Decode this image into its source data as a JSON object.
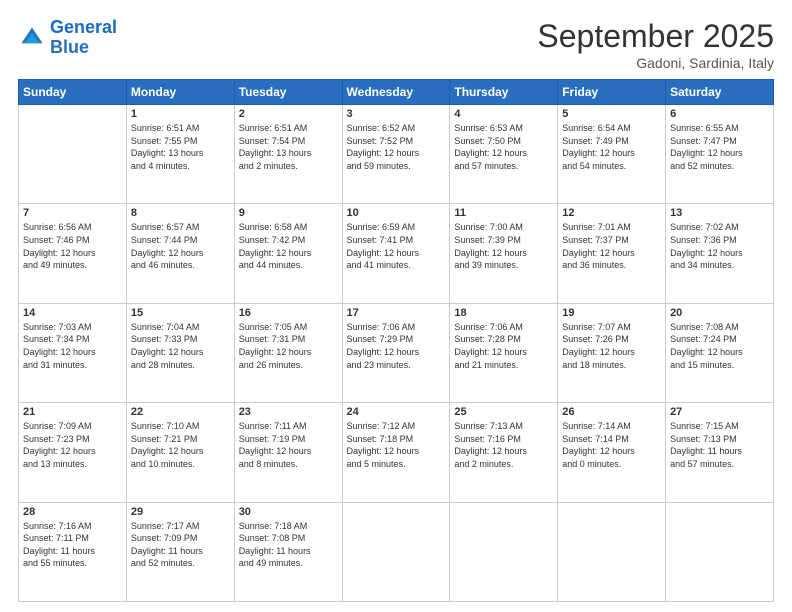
{
  "header": {
    "logo_line1": "General",
    "logo_line2": "Blue",
    "month": "September 2025",
    "location": "Gadoni, Sardinia, Italy"
  },
  "weekdays": [
    "Sunday",
    "Monday",
    "Tuesday",
    "Wednesday",
    "Thursday",
    "Friday",
    "Saturday"
  ],
  "weeks": [
    [
      {
        "day": "",
        "info": ""
      },
      {
        "day": "1",
        "info": "Sunrise: 6:51 AM\nSunset: 7:55 PM\nDaylight: 13 hours\nand 4 minutes."
      },
      {
        "day": "2",
        "info": "Sunrise: 6:51 AM\nSunset: 7:54 PM\nDaylight: 13 hours\nand 2 minutes."
      },
      {
        "day": "3",
        "info": "Sunrise: 6:52 AM\nSunset: 7:52 PM\nDaylight: 12 hours\nand 59 minutes."
      },
      {
        "day": "4",
        "info": "Sunrise: 6:53 AM\nSunset: 7:50 PM\nDaylight: 12 hours\nand 57 minutes."
      },
      {
        "day": "5",
        "info": "Sunrise: 6:54 AM\nSunset: 7:49 PM\nDaylight: 12 hours\nand 54 minutes."
      },
      {
        "day": "6",
        "info": "Sunrise: 6:55 AM\nSunset: 7:47 PM\nDaylight: 12 hours\nand 52 minutes."
      }
    ],
    [
      {
        "day": "7",
        "info": "Sunrise: 6:56 AM\nSunset: 7:46 PM\nDaylight: 12 hours\nand 49 minutes."
      },
      {
        "day": "8",
        "info": "Sunrise: 6:57 AM\nSunset: 7:44 PM\nDaylight: 12 hours\nand 46 minutes."
      },
      {
        "day": "9",
        "info": "Sunrise: 6:58 AM\nSunset: 7:42 PM\nDaylight: 12 hours\nand 44 minutes."
      },
      {
        "day": "10",
        "info": "Sunrise: 6:59 AM\nSunset: 7:41 PM\nDaylight: 12 hours\nand 41 minutes."
      },
      {
        "day": "11",
        "info": "Sunrise: 7:00 AM\nSunset: 7:39 PM\nDaylight: 12 hours\nand 39 minutes."
      },
      {
        "day": "12",
        "info": "Sunrise: 7:01 AM\nSunset: 7:37 PM\nDaylight: 12 hours\nand 36 minutes."
      },
      {
        "day": "13",
        "info": "Sunrise: 7:02 AM\nSunset: 7:36 PM\nDaylight: 12 hours\nand 34 minutes."
      }
    ],
    [
      {
        "day": "14",
        "info": "Sunrise: 7:03 AM\nSunset: 7:34 PM\nDaylight: 12 hours\nand 31 minutes."
      },
      {
        "day": "15",
        "info": "Sunrise: 7:04 AM\nSunset: 7:33 PM\nDaylight: 12 hours\nand 28 minutes."
      },
      {
        "day": "16",
        "info": "Sunrise: 7:05 AM\nSunset: 7:31 PM\nDaylight: 12 hours\nand 26 minutes."
      },
      {
        "day": "17",
        "info": "Sunrise: 7:06 AM\nSunset: 7:29 PM\nDaylight: 12 hours\nand 23 minutes."
      },
      {
        "day": "18",
        "info": "Sunrise: 7:06 AM\nSunset: 7:28 PM\nDaylight: 12 hours\nand 21 minutes."
      },
      {
        "day": "19",
        "info": "Sunrise: 7:07 AM\nSunset: 7:26 PM\nDaylight: 12 hours\nand 18 minutes."
      },
      {
        "day": "20",
        "info": "Sunrise: 7:08 AM\nSunset: 7:24 PM\nDaylight: 12 hours\nand 15 minutes."
      }
    ],
    [
      {
        "day": "21",
        "info": "Sunrise: 7:09 AM\nSunset: 7:23 PM\nDaylight: 12 hours\nand 13 minutes."
      },
      {
        "day": "22",
        "info": "Sunrise: 7:10 AM\nSunset: 7:21 PM\nDaylight: 12 hours\nand 10 minutes."
      },
      {
        "day": "23",
        "info": "Sunrise: 7:11 AM\nSunset: 7:19 PM\nDaylight: 12 hours\nand 8 minutes."
      },
      {
        "day": "24",
        "info": "Sunrise: 7:12 AM\nSunset: 7:18 PM\nDaylight: 12 hours\nand 5 minutes."
      },
      {
        "day": "25",
        "info": "Sunrise: 7:13 AM\nSunset: 7:16 PM\nDaylight: 12 hours\nand 2 minutes."
      },
      {
        "day": "26",
        "info": "Sunrise: 7:14 AM\nSunset: 7:14 PM\nDaylight: 12 hours\nand 0 minutes."
      },
      {
        "day": "27",
        "info": "Sunrise: 7:15 AM\nSunset: 7:13 PM\nDaylight: 11 hours\nand 57 minutes."
      }
    ],
    [
      {
        "day": "28",
        "info": "Sunrise: 7:16 AM\nSunset: 7:11 PM\nDaylight: 11 hours\nand 55 minutes."
      },
      {
        "day": "29",
        "info": "Sunrise: 7:17 AM\nSunset: 7:09 PM\nDaylight: 11 hours\nand 52 minutes."
      },
      {
        "day": "30",
        "info": "Sunrise: 7:18 AM\nSunset: 7:08 PM\nDaylight: 11 hours\nand 49 minutes."
      },
      {
        "day": "",
        "info": ""
      },
      {
        "day": "",
        "info": ""
      },
      {
        "day": "",
        "info": ""
      },
      {
        "day": "",
        "info": ""
      }
    ]
  ]
}
